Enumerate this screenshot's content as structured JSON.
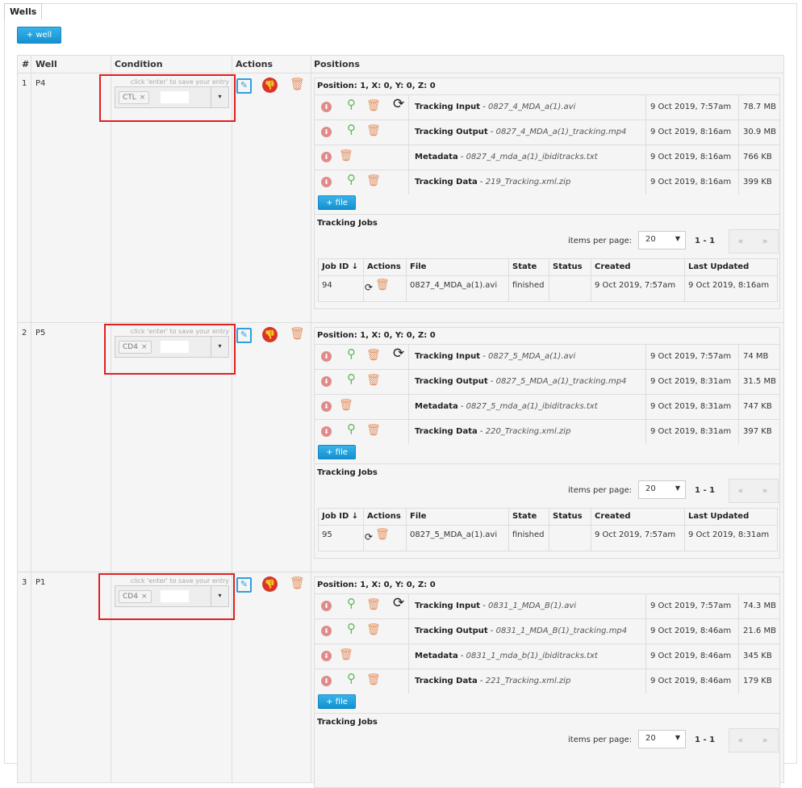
{
  "panel": {
    "title": "Wells",
    "add_well_label": "+ well"
  },
  "grid": {
    "headers": {
      "num": "#",
      "well": "Well",
      "condition": "Condition",
      "actions": "Actions",
      "positions": "Positions"
    }
  },
  "labels": {
    "condition_hint": "click 'enter' to save your entry",
    "tag_remove": "×",
    "caret": "▾",
    "add_file": "+ file",
    "tracking_jobs": "Tracking Jobs",
    "items_per_page": "items per page:",
    "prev": "«",
    "next": "»",
    "job_headers": {
      "job_id": "Job ID ↓",
      "actions": "Actions",
      "file": "File",
      "state": "State",
      "status": "Status",
      "created": "Created",
      "updated": "Last Updated"
    }
  },
  "icons": {
    "edit": "edit-icon",
    "disapprove": "thumbs-down-icon",
    "delete": "trash-icon",
    "stop": "stop-icon",
    "view": "search-icon",
    "retry": "refresh-icon"
  },
  "colors": {
    "accent": "#1a9ad9",
    "danger": "#d9342b",
    "highlight": "#e02020",
    "ok": "#5cb85c"
  },
  "wells": [
    {
      "num": "1",
      "name": "P4",
      "condition_tag": "CTL",
      "position_title": "Position: 1, X: 0, Y: 0, Z: 0",
      "files": [
        {
          "type": "Tracking Input",
          "name": "0827_4_MDA_a(1).avi",
          "date": "9 Oct 2019, 7:57am",
          "size": "78.7 MB",
          "icons": [
            "stop",
            "search",
            "trash",
            "refresh"
          ]
        },
        {
          "type": "Tracking Output",
          "name": "0827_4_MDA_a(1)_tracking.mp4",
          "date": "9 Oct 2019, 8:16am",
          "size": "30.9 MB",
          "icons": [
            "stop",
            "search",
            "trash"
          ]
        },
        {
          "type": "Metadata",
          "name": "0827_4_mda_a(1)_ibiditracks.txt",
          "date": "9 Oct 2019, 8:16am",
          "size": "766 KB",
          "icons": [
            "stop",
            "trash"
          ]
        },
        {
          "type": "Tracking Data",
          "name": "219_Tracking.xml.zip",
          "date": "9 Oct 2019, 8:16am",
          "size": "399 KB",
          "icons": [
            "stop",
            "search",
            "trash"
          ]
        }
      ],
      "items_per_page": "20",
      "page_range": "1 - 1",
      "job": {
        "id": "94",
        "file": "0827_4_MDA_a(1).avi",
        "state": "finished",
        "status": "",
        "created": "9 Oct 2019, 7:57am",
        "updated": "9 Oct 2019, 8:16am"
      }
    },
    {
      "num": "2",
      "name": "P5",
      "condition_tag": "CD4",
      "position_title": "Position: 1, X: 0, Y: 0, Z: 0",
      "files": [
        {
          "type": "Tracking Input",
          "name": "0827_5_MDA_a(1).avi",
          "date": "9 Oct 2019, 7:57am",
          "size": "74 MB",
          "icons": [
            "stop",
            "search",
            "trash",
            "refresh"
          ]
        },
        {
          "type": "Tracking Output",
          "name": "0827_5_MDA_a(1)_tracking.mp4",
          "date": "9 Oct 2019, 8:31am",
          "size": "31.5 MB",
          "icons": [
            "stop",
            "search",
            "trash"
          ]
        },
        {
          "type": "Metadata",
          "name": "0827_5_mda_a(1)_ibiditracks.txt",
          "date": "9 Oct 2019, 8:31am",
          "size": "747 KB",
          "icons": [
            "stop",
            "trash"
          ]
        },
        {
          "type": "Tracking Data",
          "name": "220_Tracking.xml.zip",
          "date": "9 Oct 2019, 8:31am",
          "size": "397 KB",
          "icons": [
            "stop",
            "search",
            "trash"
          ]
        }
      ],
      "items_per_page": "20",
      "page_range": "1 - 1",
      "job": {
        "id": "95",
        "file": "0827_5_MDA_a(1).avi",
        "state": "finished",
        "status": "",
        "created": "9 Oct 2019, 7:57am",
        "updated": "9 Oct 2019, 8:31am"
      }
    },
    {
      "num": "3",
      "name": "P1",
      "condition_tag": "CD4",
      "position_title": "Position: 1, X: 0, Y: 0, Z: 0",
      "files": [
        {
          "type": "Tracking Input",
          "name": "0831_1_MDA_B(1).avi",
          "date": "9 Oct 2019, 7:57am",
          "size": "74.3 MB",
          "icons": [
            "stop",
            "search",
            "trash",
            "refresh"
          ]
        },
        {
          "type": "Tracking Output",
          "name": "0831_1_MDA_B(1)_tracking.mp4",
          "date": "9 Oct 2019, 8:46am",
          "size": "21.6 MB",
          "icons": [
            "stop",
            "search",
            "trash"
          ]
        },
        {
          "type": "Metadata",
          "name": "0831_1_mda_b(1)_ibiditracks.txt",
          "date": "9 Oct 2019, 8:46am",
          "size": "345 KB",
          "icons": [
            "stop",
            "trash"
          ]
        },
        {
          "type": "Tracking Data",
          "name": "221_Tracking.xml.zip",
          "date": "9 Oct 2019, 8:46am",
          "size": "179 KB",
          "icons": [
            "stop",
            "search",
            "trash"
          ]
        }
      ],
      "items_per_page": "20",
      "page_range": "1 - 1",
      "job": null
    }
  ]
}
